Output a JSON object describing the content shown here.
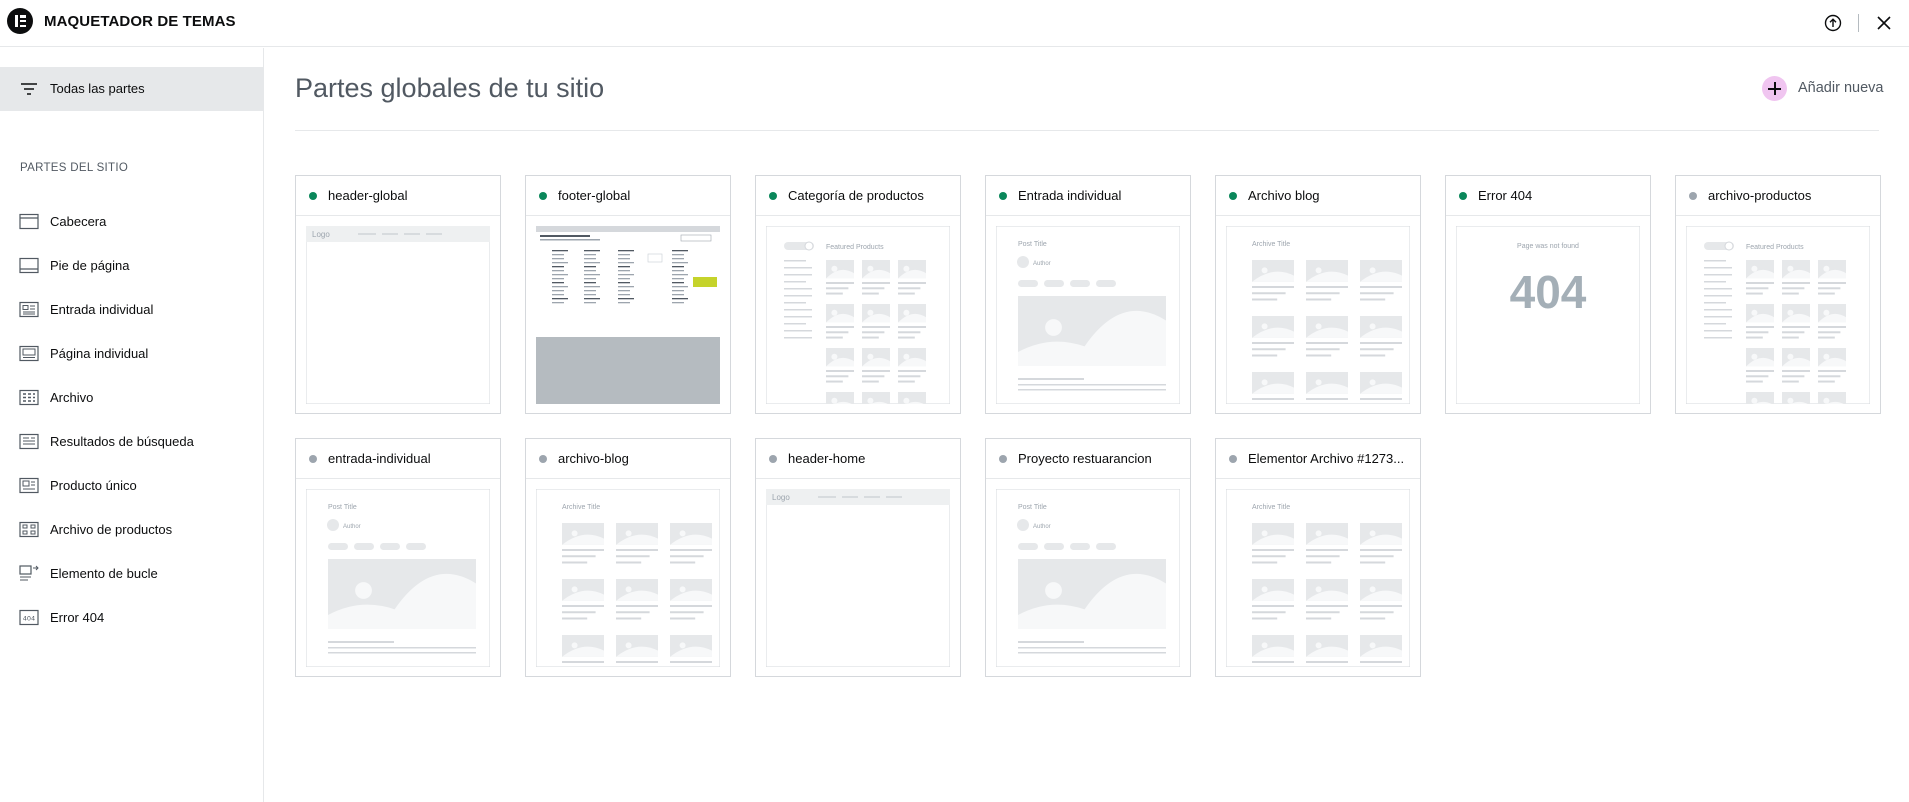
{
  "app": {
    "title": "MAQUETADOR DE TEMAS",
    "logo_icon": "elementor-logo",
    "help_icon": "upload-circle-icon",
    "close_icon": "close-icon"
  },
  "sidebar": {
    "all_parts_label": "Todas las partes",
    "section_title": "PARTES DEL SITIO",
    "items": [
      {
        "label": "Cabecera",
        "icon": "header-icon"
      },
      {
        "label": "Pie de página",
        "icon": "footer-icon"
      },
      {
        "label": "Entrada individual",
        "icon": "single-post-icon"
      },
      {
        "label": "Página individual",
        "icon": "single-page-icon"
      },
      {
        "label": "Archivo",
        "icon": "archive-icon"
      },
      {
        "label": "Resultados de búsqueda",
        "icon": "search-results-icon"
      },
      {
        "label": "Producto único",
        "icon": "single-product-icon"
      },
      {
        "label": "Archivo de productos",
        "icon": "products-archive-icon"
      },
      {
        "label": "Elemento de bucle",
        "icon": "loop-item-icon"
      },
      {
        "label": "Error 404",
        "icon": "error-404-icon"
      }
    ]
  },
  "main": {
    "title": "Partes globales de tu sitio",
    "add_new_label": "Añadir nueva",
    "colors": {
      "active": "#0a875a",
      "inactive": "#9da5ae",
      "add_accent": "#f0c5f0"
    },
    "cards": [
      {
        "name": "header-global",
        "active": true,
        "preview": "header"
      },
      {
        "name": "footer-global",
        "active": true,
        "preview": "footer"
      },
      {
        "name": "Categoría de productos",
        "active": true,
        "preview": "products"
      },
      {
        "name": "Entrada individual",
        "active": true,
        "preview": "single"
      },
      {
        "name": "Archivo blog",
        "active": true,
        "preview": "archive"
      },
      {
        "name": "Error 404",
        "active": true,
        "preview": "error404"
      },
      {
        "name": "archivo-productos",
        "active": false,
        "preview": "products"
      },
      {
        "name": "entrada-individual",
        "active": false,
        "preview": "single"
      },
      {
        "name": "archivo-blog",
        "active": false,
        "preview": "archive"
      },
      {
        "name": "header-home",
        "active": false,
        "preview": "header"
      },
      {
        "name": "Proyecto restuarancion",
        "active": false,
        "preview": "single"
      },
      {
        "name": "Elementor Archivo #1273...",
        "active": false,
        "preview": "archive"
      }
    ],
    "preview_text": {
      "logo": "Logo",
      "featured": "Featured Products",
      "post_title": "Post Title",
      "author": "Author",
      "archive_title": "Archive Title",
      "not_found": "Page was not found",
      "error_code": "404"
    }
  }
}
